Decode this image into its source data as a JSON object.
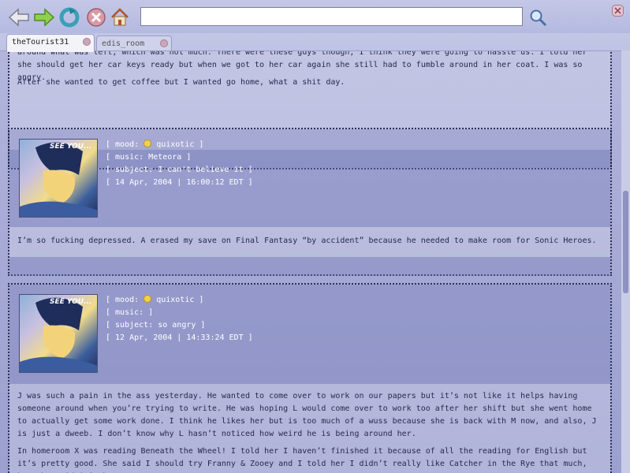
{
  "toolbar": {
    "icons": [
      "back-arrow-icon",
      "forward-arrow-icon",
      "reload-icon",
      "stop-icon",
      "home-icon",
      "search-icon"
    ],
    "url_value": "",
    "close_icon": "close-icon"
  },
  "tabs": [
    {
      "label": "theTourist31",
      "active": true
    },
    {
      "label": "edis_room",
      "active": false
    }
  ],
  "entries": [
    {
      "paragraphs": [
        "around what was left, which was not much. There were these guys though, I think they were going to hassle us. I told her she should get her car keys ready but when we got to her car again she still had to fumble around in her coat. I was so angry.",
        "After she wanted to get coffee but I wanted go home, what a shit day."
      ]
    },
    {
      "avatar_caption": "SEE YOU...",
      "mood_label": "[ mood: ",
      "mood_value": "quixotic ]",
      "music": "[ music: Meteora ]",
      "subject": "[ subject: I can't believe it ]",
      "date": "[ 14 Apr, 2004 | 16:00:12 EDT ]",
      "paragraphs": [
        "I’m so fucking depressed. A erased my save on Final Fantasy “by accident” because he needed to make room for Sonic Heroes."
      ]
    },
    {
      "avatar_caption": "SEE YOU...",
      "mood_label": "[ mood: ",
      "mood_value": "quixotic ]",
      "music": "[ music: ]",
      "subject": "[ subject: so angry ]",
      "date": "[ 12 Apr, 2004 | 14:33:24 EDT ]",
      "paragraphs": [
        "J was such a pain in the ass yesterday. He wanted to come over to work on our papers but it’s not like it helps having someone around when you’re trying to write. He was hoping L would come over to work too after her shift but she went home to actually get some work done. I think he likes her but is too much of a wuss because she is back with M now, and also, J is just a dweeb. I don’t know why L hasn’t noticed how weird he is being around her.",
        "In homeroom X was reading Beneath the Wheel! I told her I haven’t finished it because of all the reading for English but it’s pretty good. She said I should try Franny & Zooey and I told her I didn’t really like Catcher in the Rye that much, but she said it’s better. I"
      ]
    }
  ]
}
